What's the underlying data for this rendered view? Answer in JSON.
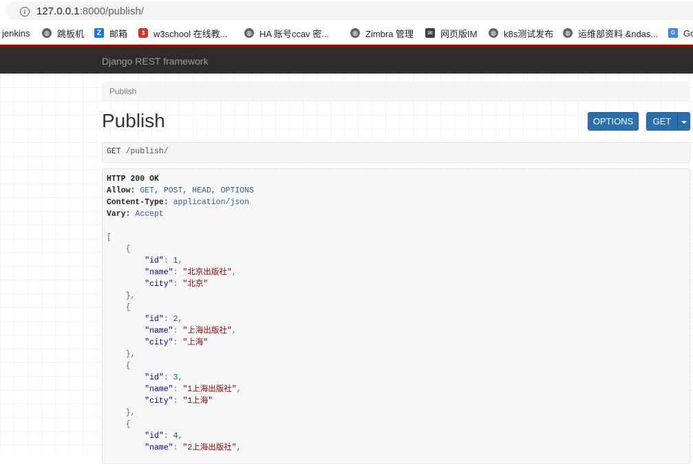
{
  "browser": {
    "url_host": "127.0.0.1",
    "url_path": ":8000/publish/",
    "bookmarks": [
      {
        "label": "jenkins",
        "icon": "none"
      },
      {
        "label": "跳板机",
        "icon": "globe-icon"
      },
      {
        "label": "邮箱",
        "icon": "zimbra-z-icon"
      },
      {
        "label": "w3school 在线教...",
        "icon": "w3school-icon"
      },
      {
        "label": "HA  账号ccav  密...",
        "icon": "globe-icon"
      },
      {
        "label": "Zimbra 管理",
        "icon": "globe-icon"
      },
      {
        "label": "网页版IM",
        "icon": "im-icon"
      },
      {
        "label": "k8s测试发布",
        "icon": "globe-icon"
      },
      {
        "label": "运维部资料 &ndas...",
        "icon": "globe-icon"
      },
      {
        "label": "Go",
        "icon": "google-translate-icon"
      }
    ]
  },
  "navbar": {
    "brand": "Django REST framework"
  },
  "breadcrumb": {
    "item": "Publish"
  },
  "page": {
    "title": "Publish",
    "options_label": "OPTIONS",
    "get_label": "GET"
  },
  "request": {
    "method": "GET",
    "path": "/publish/"
  },
  "response": {
    "status": "HTTP 200 OK",
    "headers": [
      {
        "key": "Allow",
        "value": "GET, POST, HEAD, OPTIONS"
      },
      {
        "key": "Content-Type",
        "value": "application/json"
      },
      {
        "key": "Vary",
        "value": "Accept"
      }
    ],
    "items": [
      {
        "id": "1",
        "name": "北京出版社",
        "city": "北京"
      },
      {
        "id": "2",
        "name": "上海出版社",
        "city": "上海"
      },
      {
        "id": "3",
        "name": "1上海出版社",
        "city": "1上海"
      },
      {
        "id": "4",
        "name": "2上海出版社"
      }
    ]
  },
  "colors": {
    "navbar_bg": "#2c2c2c",
    "navbar_accent": "#a30000",
    "button_primary": "#2c6fad"
  }
}
